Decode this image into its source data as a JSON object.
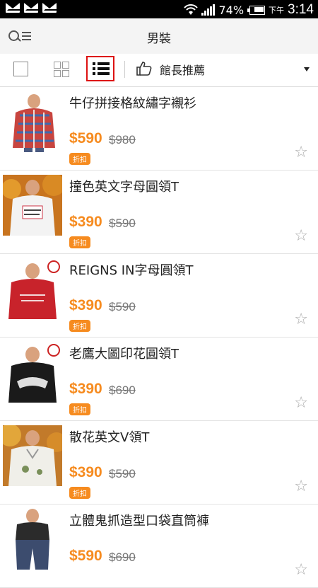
{
  "status_bar": {
    "battery": "74%",
    "time_prefix": "下午",
    "time": "3:14"
  },
  "header": {
    "title": "男裝"
  },
  "toolbar": {
    "sort_label": "館長推薦",
    "sort_icon": "thumbs-up-icon",
    "active_view": "list"
  },
  "products": [
    {
      "name": "牛仔拼接格紋繡字襯衫",
      "price": "$590",
      "original_price": "$980",
      "badge": "折扣"
    },
    {
      "name": "撞色英文字母圓領T",
      "price": "$390",
      "original_price": "$590",
      "badge": "折扣"
    },
    {
      "name": "REIGNS IN字母圓領T",
      "price": "$390",
      "original_price": "$590",
      "badge": "折扣"
    },
    {
      "name": "老鷹大圖印花圓領T",
      "price": "$390",
      "original_price": "$690",
      "badge": "折扣"
    },
    {
      "name": "散花英文V領T",
      "price": "$390",
      "original_price": "$590",
      "badge": "折扣"
    },
    {
      "name": "立體鬼抓造型口袋直筒褲",
      "price": "$590",
      "original_price": "$690",
      "badge": ""
    }
  ],
  "colors": {
    "accent": "#f68b1f",
    "active_view_border": "#dd1111"
  }
}
